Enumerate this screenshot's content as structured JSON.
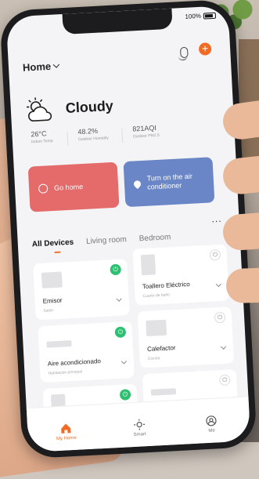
{
  "status": {
    "battery": "100%"
  },
  "header": {
    "title": "Home"
  },
  "weather": {
    "condition": "Cloudy",
    "stats": [
      {
        "value": "26°C",
        "label": "Indoor Temp"
      },
      {
        "value": "48.2%",
        "label": "Outdoor Humidity"
      },
      {
        "value": "821AQI",
        "label": "Outdoor PM2.5"
      }
    ]
  },
  "scenes": [
    {
      "label": "Go home",
      "icon": "clock-icon",
      "color": "#e56a6a"
    },
    {
      "label": "Turn on the air conditioner",
      "icon": "location-pin-icon",
      "color": "#6a86c6"
    }
  ],
  "tabs": [
    "All Devices",
    "Living room",
    "Bedroom"
  ],
  "more": "...",
  "devices": [
    {
      "name": "Emisor",
      "room": "Salón",
      "on": true
    },
    {
      "name": "Toallero Eléctrico",
      "room": "Cuarto de baño",
      "on": false
    },
    {
      "name": "Aire acondicionado",
      "room": "Habitación principal",
      "on": true
    },
    {
      "name": "Calefactor",
      "room": "Cocina",
      "on": false
    },
    {
      "name": "",
      "room": "",
      "on": true
    },
    {
      "name": "",
      "room": "",
      "on": false
    }
  ],
  "nav": [
    {
      "label": "My Home",
      "icon": "home-icon"
    },
    {
      "label": "Smart",
      "icon": "sun-icon"
    },
    {
      "label": "Me",
      "icon": "user-icon"
    }
  ],
  "colors": {
    "accent": "#f26b22",
    "power_on": "#2fbf71"
  }
}
